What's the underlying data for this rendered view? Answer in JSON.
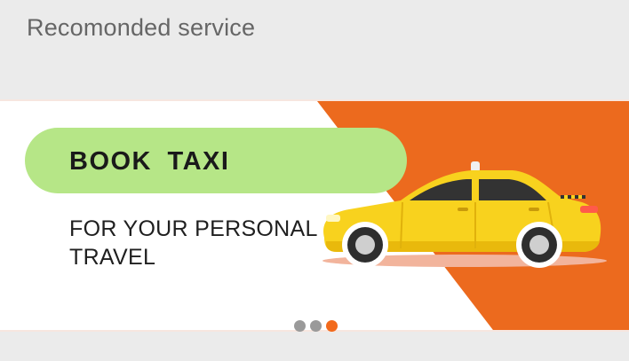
{
  "section": {
    "title": "Recomonded service"
  },
  "banner": {
    "headline": "BOOK TAXI",
    "subtitle_line1": "FOR YOUR PERSONAL",
    "subtitle_line2": "TRAVEL",
    "image": "taxi-car-illustration",
    "colors": {
      "accent": "#EC6A1E",
      "pill": "#B6E687",
      "taxi": "#F8D21E"
    }
  },
  "carousel": {
    "slides": 3,
    "active_index": 3
  }
}
